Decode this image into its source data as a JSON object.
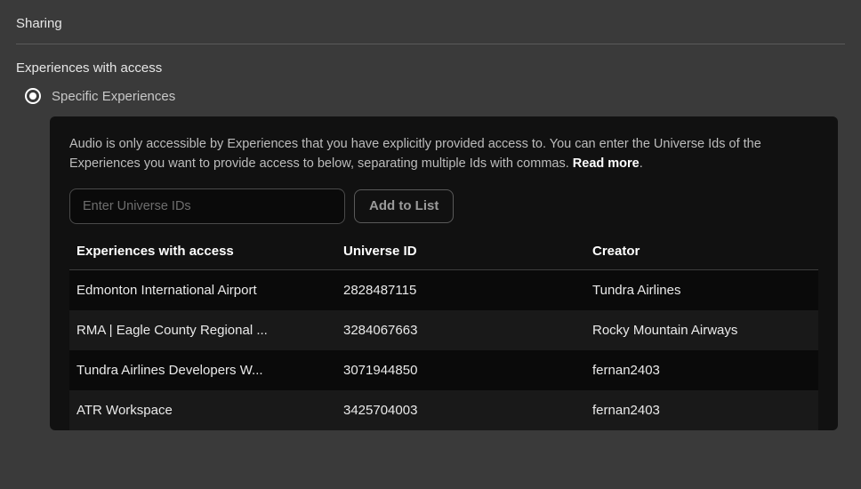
{
  "section": {
    "title": "Sharing",
    "subsection": "Experiences with access",
    "radio_label": "Specific Experiences"
  },
  "panel": {
    "description_pre": "Audio is only accessible by Experiences that you have explicitly provided access to. You can enter the Universe Ids of the Experiences you want to provide access to below, separating multiple Ids with commas. ",
    "read_more": "Read more",
    "description_post": ".",
    "input_placeholder": "Enter Universe IDs",
    "add_button": "Add to List"
  },
  "table": {
    "headers": {
      "name": "Experiences with access",
      "universe_id": "Universe ID",
      "creator": "Creator"
    },
    "rows": [
      {
        "name": "Edmonton International Airport",
        "universe_id": "2828487115",
        "creator": "Tundra Airlines"
      },
      {
        "name": "RMA | Eagle County Regional ...",
        "universe_id": "3284067663",
        "creator": "Rocky Mountain Airways"
      },
      {
        "name": "Tundra Airlines Developers W...",
        "universe_id": "3071944850",
        "creator": "fernan2403"
      },
      {
        "name": "ATR Workspace",
        "universe_id": "3425704003",
        "creator": "fernan2403"
      }
    ]
  }
}
